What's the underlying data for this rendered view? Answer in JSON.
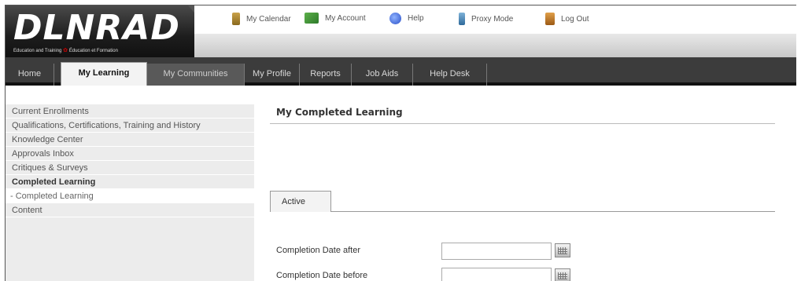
{
  "header": {
    "logo_text": "DLNRAD",
    "logo_sub_left": "Education and Training",
    "logo_sub_right": "Éducation et Formation",
    "utilities": [
      {
        "label": "My Calendar",
        "icon": "calendar-icon"
      },
      {
        "label": "My Account",
        "icon": "account-icon"
      },
      {
        "label": "Help",
        "icon": "help-icon"
      },
      {
        "label": "Proxy Mode",
        "icon": "proxy-icon"
      },
      {
        "label": "Log Out",
        "icon": "logout-icon"
      }
    ]
  },
  "nav": {
    "tabs": [
      {
        "label": "Home"
      },
      {
        "label": "My Learning",
        "active": true
      },
      {
        "label": "My Communities"
      },
      {
        "label": "My Profile"
      },
      {
        "label": "Reports"
      },
      {
        "label": "Job Aids"
      },
      {
        "label": "Help Desk"
      }
    ]
  },
  "sidebar": {
    "items": [
      {
        "label": "Current Enrollments"
      },
      {
        "label": "Qualifications, Certifications, Training and History"
      },
      {
        "label": "Knowledge Center"
      },
      {
        "label": "Approvals Inbox"
      },
      {
        "label": "Critiques & Surveys"
      },
      {
        "label": "Completed Learning",
        "bold": true
      },
      {
        "label": "- Completed Learning",
        "sub": true
      },
      {
        "label": "Content"
      }
    ]
  },
  "main": {
    "title": "My Completed Learning",
    "tab_active": "Active",
    "fields": [
      {
        "label": "Completion Date after",
        "value": "",
        "placeholder": ""
      },
      {
        "label": "Completion Date before",
        "value": "",
        "placeholder": ""
      }
    ]
  }
}
